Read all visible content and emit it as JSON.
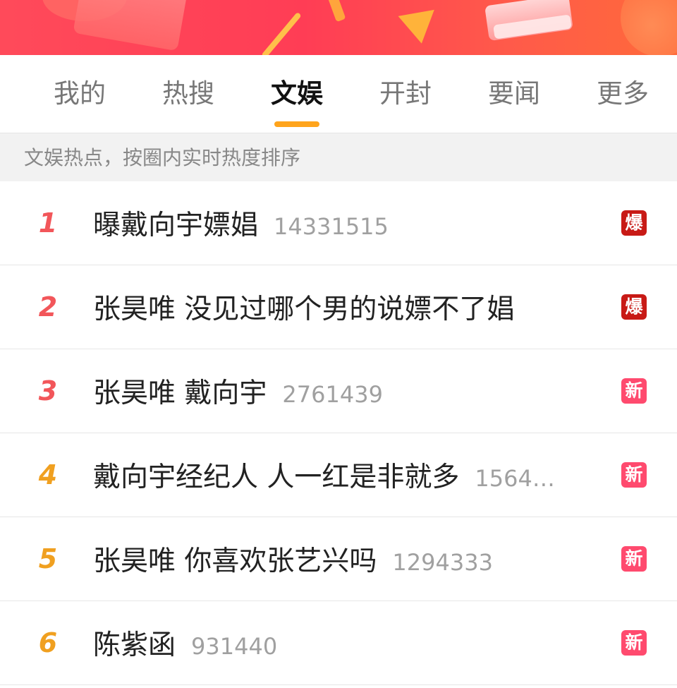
{
  "tabs": [
    {
      "label": "我的",
      "active": false
    },
    {
      "label": "热搜",
      "active": false
    },
    {
      "label": "文娱",
      "active": true
    },
    {
      "label": "开封",
      "active": false
    },
    {
      "label": "要闻",
      "active": false
    },
    {
      "label": "更多",
      "active": false
    }
  ],
  "subheader": "文娱热点，按圈内实时热度排序",
  "colors": {
    "accent": "#ffa41c",
    "top_rank": "#f2565a",
    "rank": "#f0a020",
    "badge_bao": "#c81a16",
    "badge_xin": "#ff4a6e"
  },
  "items": [
    {
      "rank": "1",
      "title": "曝戴向宇嫖娼",
      "count": "14331515",
      "badge": "爆"
    },
    {
      "rank": "2",
      "title": "张昊唯 没见过哪个男的说嫖不了娼",
      "count": "",
      "badge": "爆"
    },
    {
      "rank": "3",
      "title": "张昊唯 戴向宇",
      "count": "2761439",
      "badge": "新"
    },
    {
      "rank": "4",
      "title": "戴向宇经纪人 人一红是非就多",
      "count": "1564…",
      "badge": "新"
    },
    {
      "rank": "5",
      "title": "张昊唯 你喜欢张艺兴吗",
      "count": "1294333",
      "badge": "新"
    },
    {
      "rank": "6",
      "title": "陈紫函",
      "count": "931440",
      "badge": "新"
    }
  ]
}
